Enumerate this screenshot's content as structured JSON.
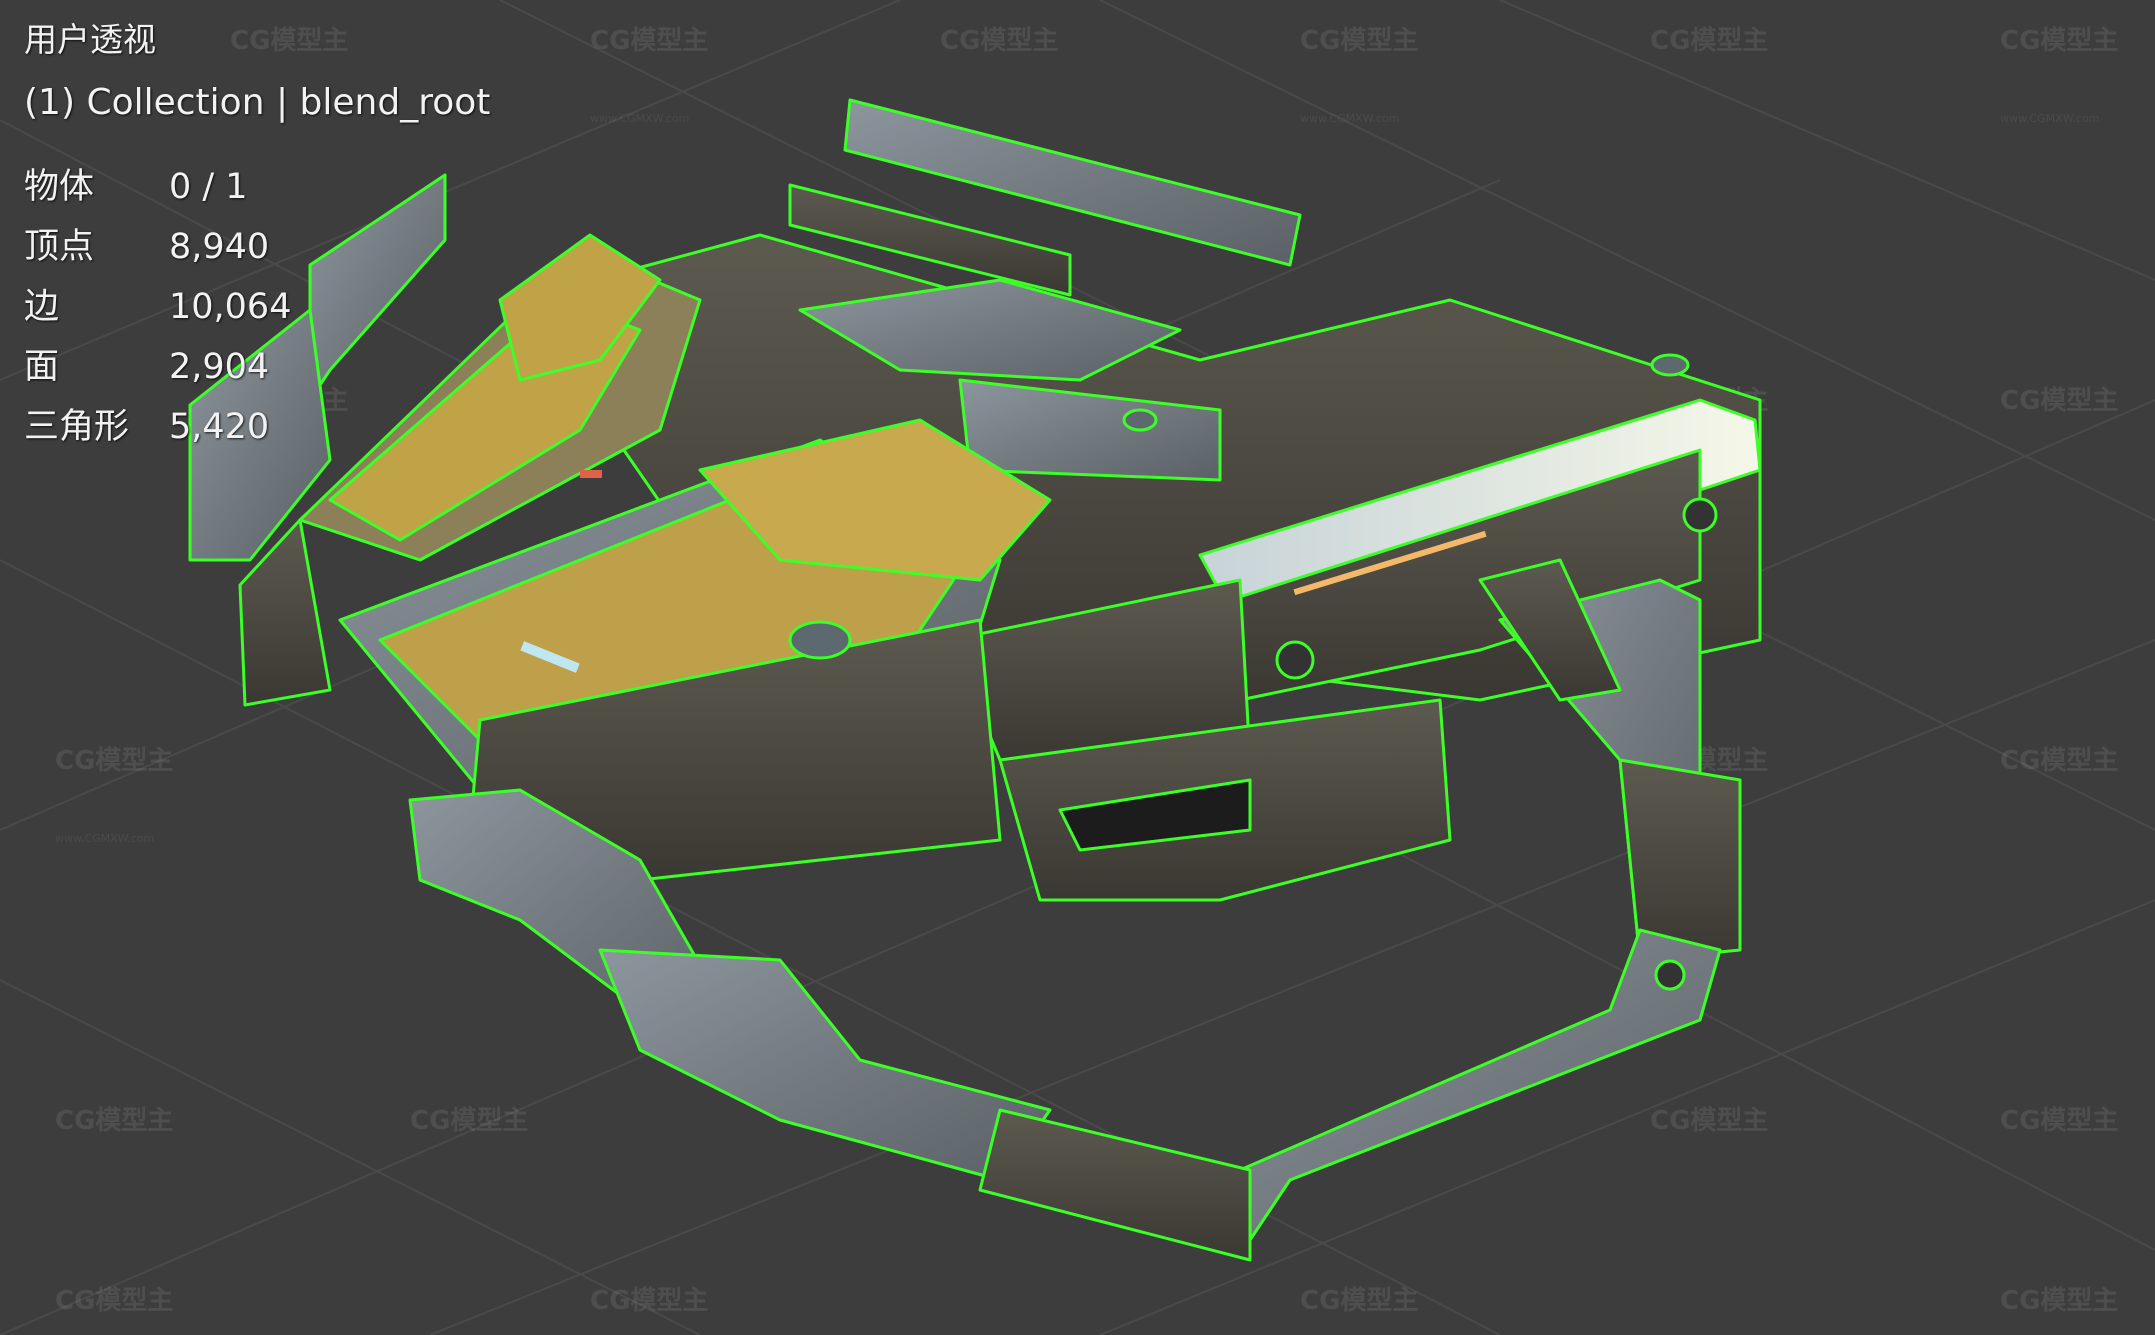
{
  "viewport": {
    "view_name": "用户透视",
    "collection_info": "(1) Collection | blend_root",
    "background_color": "#3d3d3d",
    "wireframe_color": "#3cff28",
    "stats": [
      {
        "label": "物体",
        "value": "0 / 1"
      },
      {
        "label": "顶点",
        "value": "8,940"
      },
      {
        "label": "边",
        "value": "10,064"
      },
      {
        "label": "面",
        "value": "2,904"
      },
      {
        "label": "三角形",
        "value": "5,420"
      }
    ]
  },
  "watermark": {
    "logo_text": "CG模型主",
    "url_text": "www.CGMXW.com"
  }
}
